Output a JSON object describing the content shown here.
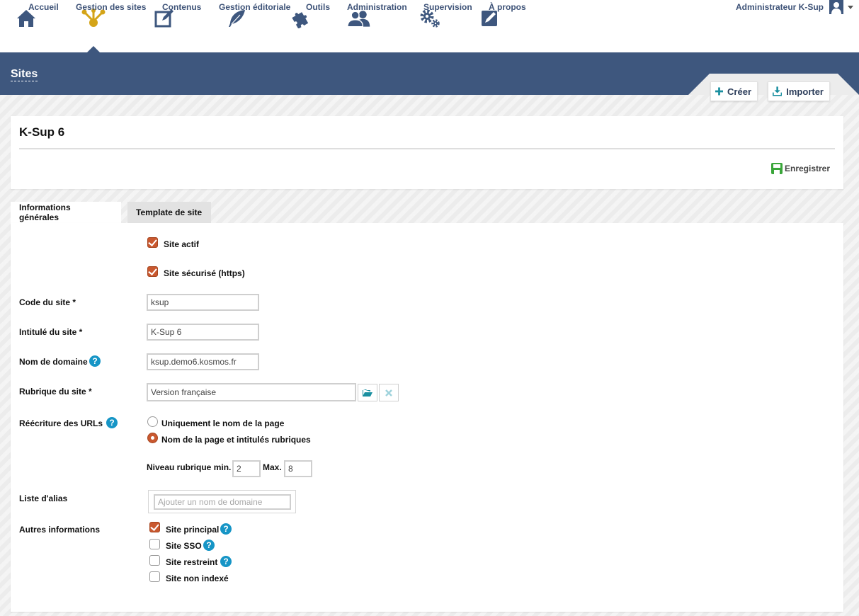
{
  "nav": {
    "items": [
      {
        "label": "Accueil",
        "icon": "home-icon"
      },
      {
        "label": "Gestion des sites",
        "icon": "site-tree-icon",
        "active": true
      },
      {
        "label": "Contenus",
        "icon": "edit-icon"
      },
      {
        "label": "Gestion éditoriale",
        "icon": "feather-icon"
      },
      {
        "label": "Outils",
        "icon": "puzzle-icon"
      },
      {
        "label": "Administration",
        "icon": "users-icon"
      },
      {
        "label": "Supervision",
        "icon": "gears-icon"
      },
      {
        "label": "À propos",
        "icon": "sign-icon"
      }
    ],
    "user": "Administrateur K-Sup"
  },
  "band": {
    "title": "Sites",
    "create_label": "Créer",
    "import_label": "Importer"
  },
  "site": {
    "title": "K-Sup 6",
    "save_label": "Enregistrer"
  },
  "tabs": [
    "Informations générales",
    "Template de site"
  ],
  "form": {
    "site_actif": {
      "label": "Site actif",
      "checked": true
    },
    "site_secure": {
      "label": "Site sécurisé (https)",
      "checked": true
    },
    "code": {
      "label": "Code du site *",
      "value": "ksup"
    },
    "intitule": {
      "label": "Intitulé du site *",
      "value": "K-Sup 6"
    },
    "domaine": {
      "label": "Nom de domaine",
      "value": "ksup.demo6.kosmos.fr"
    },
    "rubrique": {
      "label": "Rubrique du site *",
      "value": "Version française"
    },
    "rewrite": {
      "label": "Réécriture des URLs",
      "options": [
        "Uniquement le nom de la page",
        "Nom de la page et intitulés rubriques"
      ],
      "selected": 1,
      "niveau_label": "Niveau rubrique min.",
      "min": "2",
      "max_label": "Max.",
      "max": "8"
    },
    "alias": {
      "label": "Liste d'alias",
      "placeholder": "Ajouter un nom de domaine"
    },
    "autres": {
      "label": "Autres informations",
      "items": [
        {
          "label": "Site principal",
          "checked": true,
          "help": true
        },
        {
          "label": "Site SSO",
          "checked": false,
          "help": true
        },
        {
          "label": "Site restreint",
          "checked": false,
          "help": true
        },
        {
          "label": "Site non indexé",
          "checked": false,
          "help": false
        }
      ]
    }
  },
  "colors": {
    "primary": "#3e577e",
    "nav_text": "#3d5277",
    "accent_orange": "#c9582f",
    "help_blue": "#1695c6",
    "save_green": "#3aa63a",
    "create_teal": "#1a8fa0"
  }
}
